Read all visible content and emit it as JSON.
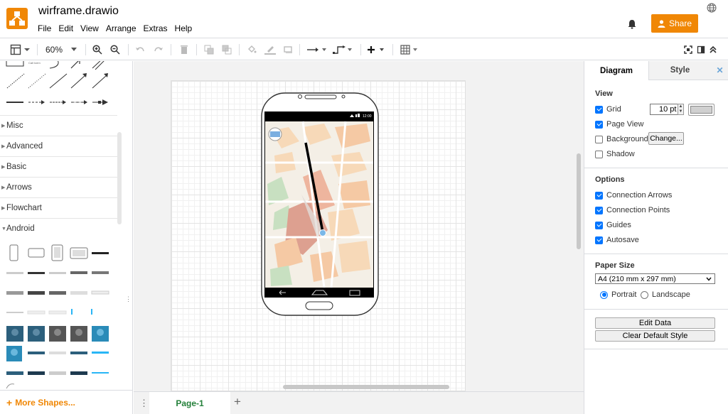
{
  "app": {
    "title": "wirframe.drawio",
    "share_label": "Share"
  },
  "menu": [
    "File",
    "Edit",
    "View",
    "Arrange",
    "Extras",
    "Help"
  ],
  "toolbar": {
    "zoom": "60%"
  },
  "sidebar": {
    "categories": [
      "Misc",
      "Advanced",
      "Basic",
      "Arrows",
      "Flowchart",
      "Android"
    ],
    "more_shapes": "More Shapes...",
    "tiny_label": "Call Icem"
  },
  "phone": {
    "status_time": "12:00"
  },
  "pages": {
    "current": "Page-1"
  },
  "format": {
    "tabs": {
      "diagram": "Diagram",
      "style": "Style"
    },
    "view": {
      "heading": "View",
      "grid": "Grid",
      "grid_size": "10 pt",
      "page_view": "Page View",
      "background": "Background",
      "change": "Change...",
      "shadow": "Shadow"
    },
    "options": {
      "heading": "Options",
      "connection_arrows": "Connection Arrows",
      "connection_points": "Connection Points",
      "guides": "Guides",
      "autosave": "Autosave"
    },
    "paper": {
      "heading": "Paper Size",
      "size": "A4 (210 mm x 297 mm)",
      "portrait": "Portrait",
      "landscape": "Landscape"
    },
    "buttons": {
      "edit_data": "Edit Data",
      "clear_style": "Clear Default Style"
    }
  },
  "colors": {
    "brand": "#f08705",
    "page_tab": "#24803a",
    "checkbox": "#0075ff"
  }
}
